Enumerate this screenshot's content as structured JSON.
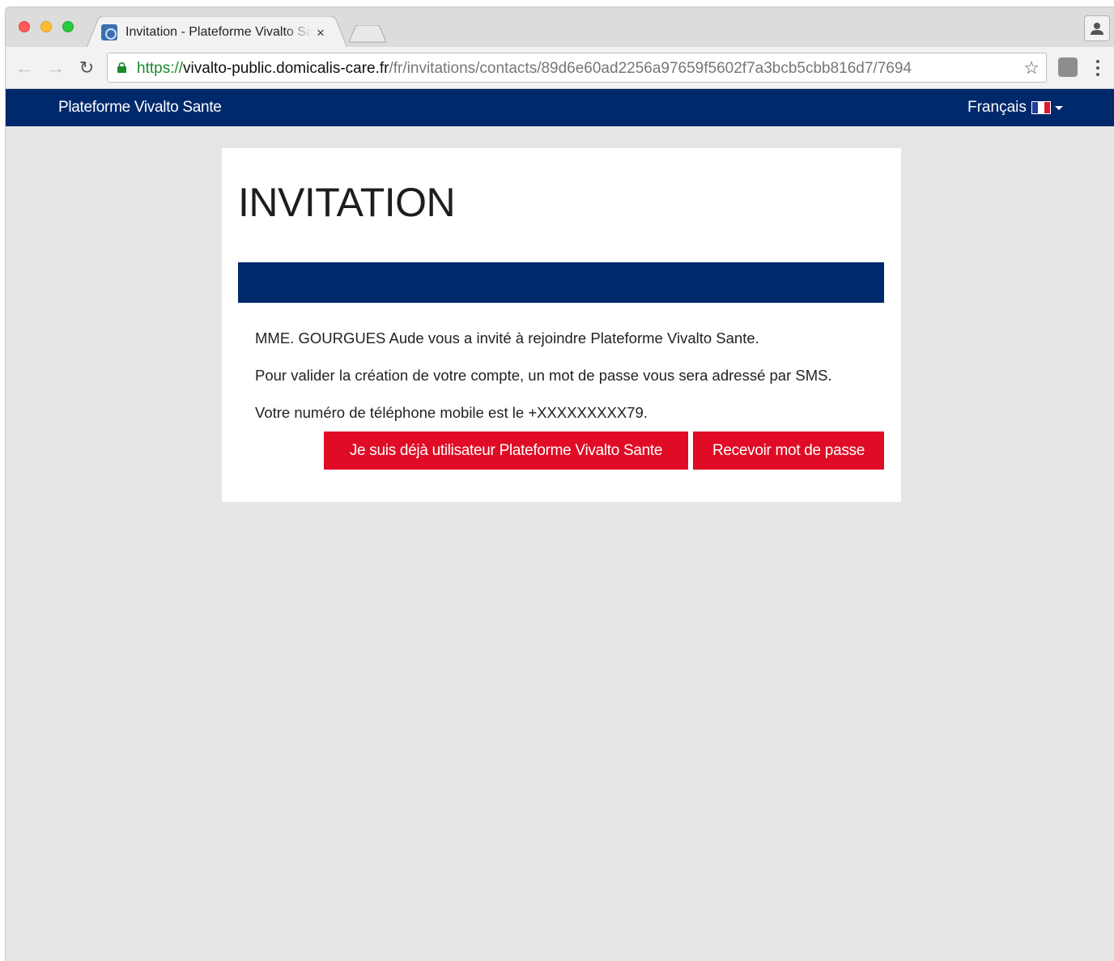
{
  "browser": {
    "tab_title": "Invitation - Plateforme Vivalto Sante",
    "tab_close": "×",
    "url_scheme": "https://",
    "url_host": "vivalto-public.domicalis-care.fr",
    "url_path": "/fr/invitations/contacts/89d6e60ad2256a97659f5602f7a3bcb5cbb816d7/7694",
    "back_glyph": "←",
    "forward_glyph": "→",
    "reload_glyph": "↻",
    "star_glyph": "☆"
  },
  "navbar": {
    "brand": "Plateforme Vivalto Sante",
    "language": "Français",
    "flag_colors": [
      "#1f3f9b",
      "#ffffff",
      "#e1192f"
    ]
  },
  "invitation": {
    "title": "INVITATION",
    "line1": "MME. GOURGUES Aude vous a invité à rejoindre Plateforme Vivalto Sante.",
    "line2": "Pour valider la création de votre compte, un mot de passe vous sera adressé par SMS.",
    "line3": "Votre numéro de téléphone mobile est le +XXXXXXXXX79.",
    "btn_existing_user": "Je suis déjà utilisateur Plateforme Vivalto Sante",
    "btn_receive_password": "Recevoir mot de passe"
  },
  "colors": {
    "navy": "#00296b",
    "accent_red": "#e00b25",
    "page_bg": "#e5e5e5"
  }
}
